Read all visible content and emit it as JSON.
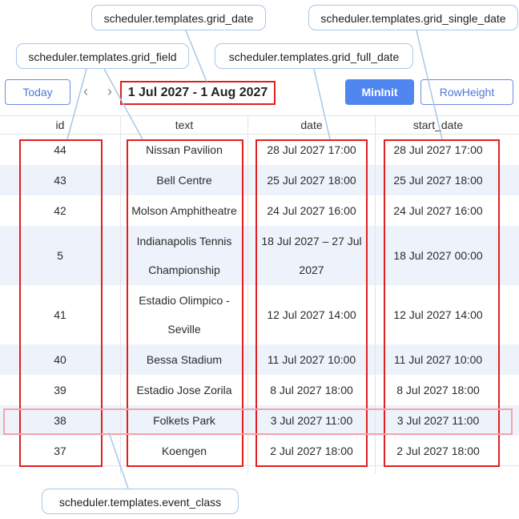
{
  "callouts": {
    "grid_date": "scheduler.templates.grid_date",
    "grid_single_date": "scheduler.templates.grid_single_date",
    "grid_field": "scheduler.templates.grid_field",
    "grid_full_date": "scheduler.templates.grid_full_date",
    "event_class": "scheduler.templates.event_class"
  },
  "toolbar": {
    "today_label": "Today",
    "prev_icon": "chevron-left-icon",
    "next_icon": "chevron-right-icon",
    "date_range": "1 Jul 2027 - 1 Aug 2027",
    "mininit_label": "MinInit",
    "rowheight_label": "RowHeight"
  },
  "grid": {
    "columns": [
      "id",
      "text",
      "date",
      "start_date"
    ],
    "rows": [
      {
        "id": "44",
        "text": "Nissan Pavilion",
        "date": "28 Jul 2027 17:00",
        "start_date": "28 Jul 2027 17:00"
      },
      {
        "id": "43",
        "text": "Bell Centre",
        "date": "25 Jul 2027 18:00",
        "start_date": "25 Jul 2027 18:00"
      },
      {
        "id": "42",
        "text": "Molson Amphitheatre",
        "date": "24 Jul 2027 16:00",
        "start_date": "24 Jul 2027 16:00"
      },
      {
        "id": "5",
        "text": "Indianapolis Tennis Championship",
        "date": "18 Jul 2027 – 27 Jul 2027",
        "start_date": "18 Jul 2027 00:00"
      },
      {
        "id": "41",
        "text": "Estadio Olimpico - Seville",
        "date": "12 Jul 2027 14:00",
        "start_date": "12 Jul 2027 14:00"
      },
      {
        "id": "40",
        "text": "Bessa Stadium",
        "date": "11 Jul 2027 10:00",
        "start_date": "11 Jul 2027 10:00"
      },
      {
        "id": "39",
        "text": "Estadio Jose Zorila",
        "date": "8 Jul 2027 18:00",
        "start_date": "8 Jul 2027 18:00"
      },
      {
        "id": "38",
        "text": "Folkets Park",
        "date": "3 Jul 2027 11:00",
        "start_date": "3 Jul 2027 11:00"
      },
      {
        "id": "37",
        "text": "Koengen",
        "date": "2 Jul 2027 18:00",
        "start_date": "2 Jul 2027 18:00"
      }
    ]
  },
  "colors": {
    "accent": "#4f86f0",
    "highlight_box": "#e02020",
    "event_class_box": "#f2a5ad",
    "alt_row": "#eef3fb",
    "callout_border": "#a9c6ea"
  }
}
